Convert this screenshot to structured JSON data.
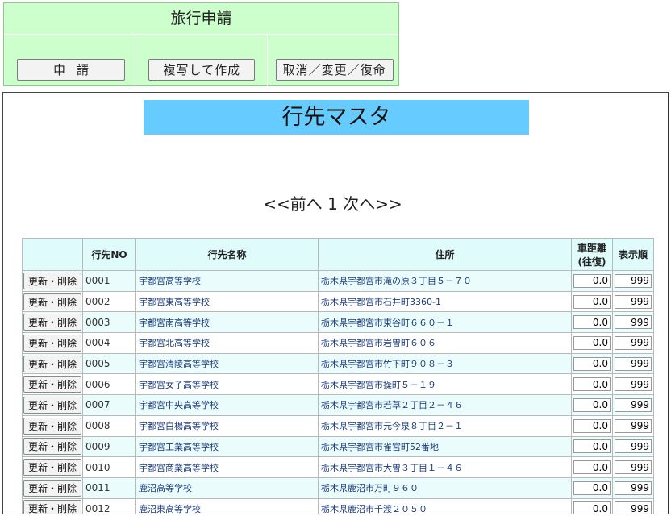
{
  "top": {
    "title": "旅行申請",
    "buttons": [
      "申請",
      "複写して作成",
      "取消／変更／復命"
    ]
  },
  "master": {
    "title": "行先マスタ",
    "pager": {
      "prev": "<<前へ",
      "page": "1",
      "next": "次へ>>"
    }
  },
  "table": {
    "headers": {
      "btn": "",
      "no": "行先NO",
      "name": "行先名称",
      "address": "住所",
      "distance": "車距離\n(往復)",
      "order": "表示順"
    },
    "button_label": "更新・削除",
    "rows": [
      {
        "no": "0001",
        "name": "宇都宮高等学校",
        "address": "栃木県宇都宮市滝の原３丁目５－７０",
        "distance": "0.0",
        "order": "999"
      },
      {
        "no": "0002",
        "name": "宇都宮東高等学校",
        "address": "栃木県宇都宮市石井町3360-1",
        "distance": "0.0",
        "order": "999"
      },
      {
        "no": "0003",
        "name": "宇都宮南高等学校",
        "address": "栃木県宇都宮市東谷町６６０－１",
        "distance": "0.0",
        "order": "999"
      },
      {
        "no": "0004",
        "name": "宇都宮北高等学校",
        "address": "栃木県宇都宮市岩曽町６０６",
        "distance": "0.0",
        "order": "999"
      },
      {
        "no": "0005",
        "name": "宇都宮清陵高等学校",
        "address": "栃木県宇都宮市竹下町９０８－３",
        "distance": "0.0",
        "order": "999"
      },
      {
        "no": "0006",
        "name": "宇都宮女子高等学校",
        "address": "栃木県宇都宮市操町５－１９",
        "distance": "0.0",
        "order": "999"
      },
      {
        "no": "0007",
        "name": "宇都宮中央高等学校",
        "address": "栃木県宇都宮市若草２丁目２－４６",
        "distance": "0.0",
        "order": "999"
      },
      {
        "no": "0008",
        "name": "宇都宮白楊高等学校",
        "address": "栃木県宇都宮市元今泉８丁目２－１",
        "distance": "0.0",
        "order": "999"
      },
      {
        "no": "0009",
        "name": "宇都宮工業高等学校",
        "address": "栃木県宇都宮市雀宮町52番地",
        "distance": "0.0",
        "order": "999"
      },
      {
        "no": "0010",
        "name": "宇都宮商業高等学校",
        "address": "栃木県宇都宮市大曽３丁目１－４６",
        "distance": "0.0",
        "order": "999"
      },
      {
        "no": "0011",
        "name": "鹿沼高等学校",
        "address": "栃木県鹿沼市万町９６０",
        "distance": "0.0",
        "order": "999"
      },
      {
        "no": "0012",
        "name": "鹿沼東高等学校",
        "address": "栃木県鹿沼市千渡２０５０",
        "distance": "0.0",
        "order": "999"
      }
    ]
  }
}
